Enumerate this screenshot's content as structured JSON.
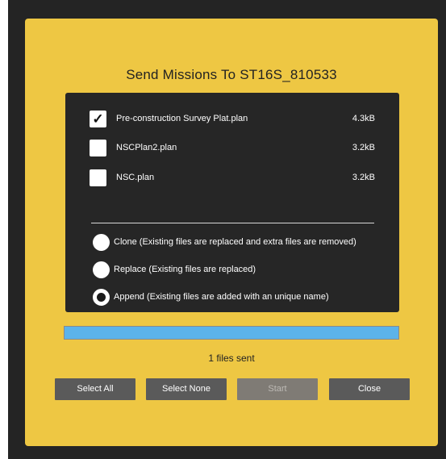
{
  "dialog": {
    "title": "Send Missions To ST16S_810533"
  },
  "files": [
    {
      "name": "Pre-construction Survey Plat.plan",
      "size": "4.3kB",
      "checked": true
    },
    {
      "name": "NSCPlan2.plan",
      "size": "3.2kB",
      "checked": false
    },
    {
      "name": "NSC.plan",
      "size": "3.2kB",
      "checked": false
    }
  ],
  "check_mark": "✓",
  "modes": [
    {
      "label": "Clone (Existing files are replaced and extra files are removed)",
      "selected": false
    },
    {
      "label": "Replace (Existing files are replaced)",
      "selected": false
    },
    {
      "label": "Append (Existing files are added with an unique name)",
      "selected": true
    }
  ],
  "progress": {
    "fraction": 1.0
  },
  "status_text": "1 files sent",
  "buttons": {
    "select_all": "Select All",
    "select_none": "Select None",
    "start": "Start",
    "close": "Close"
  },
  "colors": {
    "dialog_bg": "#eec743",
    "panel_bg": "#262626",
    "progress_fill": "#5cb3ea",
    "button_bg": "#5a5a5a"
  }
}
